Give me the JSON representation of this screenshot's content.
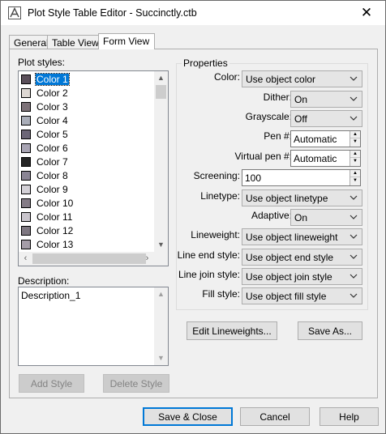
{
  "window": {
    "title": "Plot Style Table Editor - Succinctly.ctb",
    "close_glyph": "✕"
  },
  "tabs": [
    {
      "label": "General",
      "active": false
    },
    {
      "label": "Table View",
      "active": false
    },
    {
      "label": "Form View",
      "active": true
    }
  ],
  "plot_styles": {
    "label": "Plot styles:",
    "items": [
      {
        "label": "Color 1",
        "swatch": "#5a4f5a",
        "selected": true
      },
      {
        "label": "Color 2",
        "swatch": "#ddd7d2"
      },
      {
        "label": "Color 3",
        "swatch": "#7d7278"
      },
      {
        "label": "Color 4",
        "swatch": "#a9adb8"
      },
      {
        "label": "Color 5",
        "swatch": "#6c6677"
      },
      {
        "label": "Color 6",
        "swatch": "#a8a4b3"
      },
      {
        "label": "Color 7",
        "swatch": "#242424"
      },
      {
        "label": "Color 8",
        "swatch": "#8a8494"
      },
      {
        "label": "Color 9",
        "swatch": "#d3d0d6"
      },
      {
        "label": "Color 10",
        "swatch": "#847b86"
      },
      {
        "label": "Color 11",
        "swatch": "#c9c5cc"
      },
      {
        "label": "Color 12",
        "swatch": "#7e7781"
      },
      {
        "label": "Color 13",
        "swatch": "#a59da8"
      }
    ]
  },
  "description": {
    "label": "Description:",
    "value": "Description_1"
  },
  "buttons": {
    "add_style": "Add Style",
    "delete_style": "Delete Style",
    "edit_lineweights": "Edit Lineweights...",
    "save_as": "Save As...",
    "save_close": "Save & Close",
    "cancel": "Cancel",
    "help": "Help"
  },
  "properties": {
    "title": "Properties",
    "color": {
      "label": "Color:",
      "value": "Use object color"
    },
    "dither": {
      "label": "Dither:",
      "value": "On"
    },
    "grayscale": {
      "label": "Grayscale:",
      "value": "Off"
    },
    "pen": {
      "label": "Pen #:",
      "value": "Automatic"
    },
    "virtual_pen": {
      "label": "Virtual pen #:",
      "value": "Automatic"
    },
    "screening": {
      "label": "Screening:",
      "value": "100"
    },
    "linetype": {
      "label": "Linetype:",
      "value": "Use object linetype"
    },
    "adaptive": {
      "label": "Adaptive:",
      "value": "On"
    },
    "lineweight": {
      "label": "Lineweight:",
      "value": "Use object lineweight"
    },
    "line_end_style": {
      "label": "Line end style:",
      "value": "Use object end style"
    },
    "line_join_style": {
      "label": "Line join style:",
      "value": "Use object join style"
    },
    "fill_style": {
      "label": "Fill style:",
      "value": "Use object fill style"
    }
  }
}
